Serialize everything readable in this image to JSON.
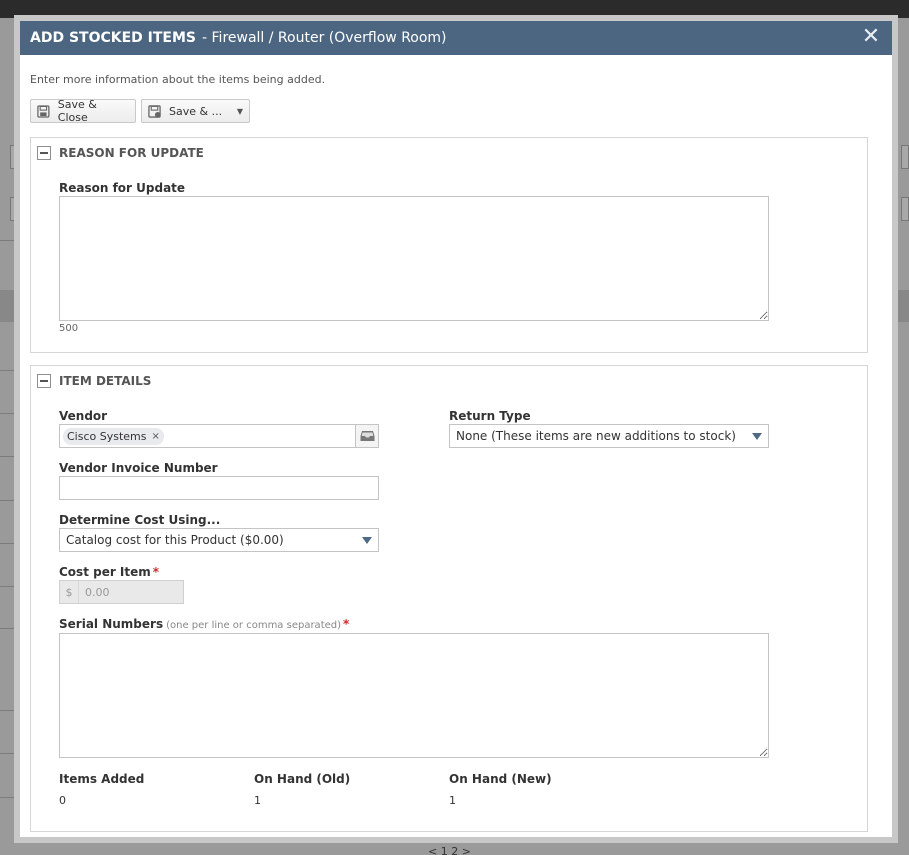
{
  "dialog": {
    "title_main": "ADD STOCKED ITEMS",
    "title_sub": "- Firewall / Router (Overflow Room)",
    "close_glyph": "✕",
    "intro": "Enter more information about the items being added."
  },
  "toolbar": {
    "save_close_label": "Save & Close",
    "save_more_label": "Save & ..."
  },
  "reason_section": {
    "title": "REASON FOR UPDATE",
    "field_label": "Reason for Update",
    "value": "",
    "char_count": "500"
  },
  "item_details": {
    "title": "ITEM DETAILS",
    "vendor": {
      "label": "Vendor",
      "tag": "Cisco Systems",
      "remove_glyph": "×"
    },
    "return_type": {
      "label": "Return Type",
      "value": "None (These items are new additions to stock)"
    },
    "invoice": {
      "label": "Vendor Invoice Number",
      "value": ""
    },
    "determine_cost": {
      "label": "Determine Cost Using...",
      "value": "Catalog cost for this Product ($0.00)"
    },
    "cost_per_item": {
      "label": "Cost per Item",
      "required_mark": "*",
      "prefix": "$",
      "value": "0.00"
    },
    "serials": {
      "label": "Serial Numbers",
      "hint": "(one per line or comma separated)",
      "required_mark": "*",
      "value": ""
    },
    "summary": [
      {
        "label": "Items Added",
        "value": "0"
      },
      {
        "label": "On Hand (Old)",
        "value": "1"
      },
      {
        "label": "On Hand (New)",
        "value": "1"
      }
    ]
  },
  "background": {
    "pager": "< 1 2 >"
  },
  "icons": {
    "save": "floppy-disk-icon",
    "save_more": "floppy-disk-plus-icon",
    "lookup": "inbox-tray-icon",
    "collapse": "minus-square-icon"
  },
  "colors": {
    "titlebar": "#4c6681",
    "required": "#cc2b2b",
    "overlay": "#8c8c8c"
  }
}
